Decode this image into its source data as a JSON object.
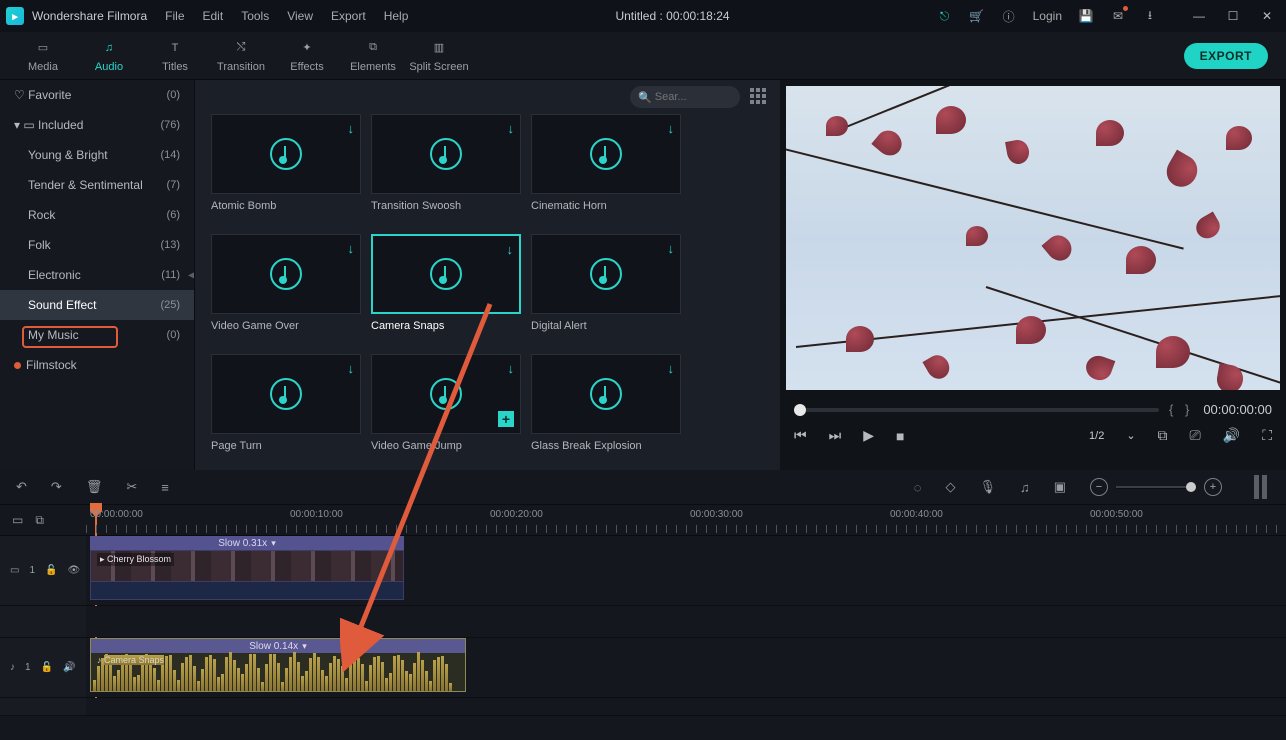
{
  "titlebar": {
    "app": "Wondershare Filmora",
    "menu": [
      "File",
      "Edit",
      "Tools",
      "View",
      "Export",
      "Help"
    ],
    "doc": "Untitled : 00:00:18:24",
    "login": "Login"
  },
  "tabs": [
    {
      "id": "media",
      "label": "Media"
    },
    {
      "id": "audio",
      "label": "Audio"
    },
    {
      "id": "titles",
      "label": "Titles"
    },
    {
      "id": "transition",
      "label": "Transition"
    },
    {
      "id": "effects",
      "label": "Effects"
    },
    {
      "id": "elements",
      "label": "Elements"
    },
    {
      "id": "split",
      "label": "Split Screen"
    }
  ],
  "export": "EXPORT",
  "sidebar": {
    "favorite": {
      "label": "Favorite",
      "count": "(0)"
    },
    "included": {
      "label": "Included",
      "count": "(76)"
    },
    "items": [
      {
        "label": "Young & Bright",
        "count": "(14)"
      },
      {
        "label": "Tender & Sentimental",
        "count": "(7)"
      },
      {
        "label": "Rock",
        "count": "(6)"
      },
      {
        "label": "Folk",
        "count": "(13)"
      },
      {
        "label": "Electronic",
        "count": "(11)"
      },
      {
        "label": "Sound Effect",
        "count": "(25)"
      },
      {
        "label": "My Music",
        "count": "(0)"
      }
    ],
    "filmstock": "Filmstock"
  },
  "search": {
    "placeholder": "Sear..."
  },
  "tiles": [
    {
      "name": "Atomic Bomb"
    },
    {
      "name": "Transition Swoosh"
    },
    {
      "name": "Cinematic Horn"
    },
    {
      "name": "Video Game Over"
    },
    {
      "name": "Camera Snaps"
    },
    {
      "name": "Digital Alert"
    },
    {
      "name": "Page Turn"
    },
    {
      "name": "Video Game Jump"
    },
    {
      "name": "Glass Break Explosion"
    }
  ],
  "preview": {
    "time": "00:00:00:00",
    "page": "1/2"
  },
  "ruler": [
    "00:00:00:00",
    "00:00:10:00",
    "00:00:20:00",
    "00:00:30:00",
    "00:00:40:00",
    "00:00:50:00"
  ],
  "tracks": {
    "video": {
      "id": "1",
      "speed": "Slow 0.31x",
      "clip": "Cherry Blossom"
    },
    "audio": {
      "id": "1",
      "speed": "Slow 0.14x",
      "clip": "Camera Snaps"
    }
  }
}
